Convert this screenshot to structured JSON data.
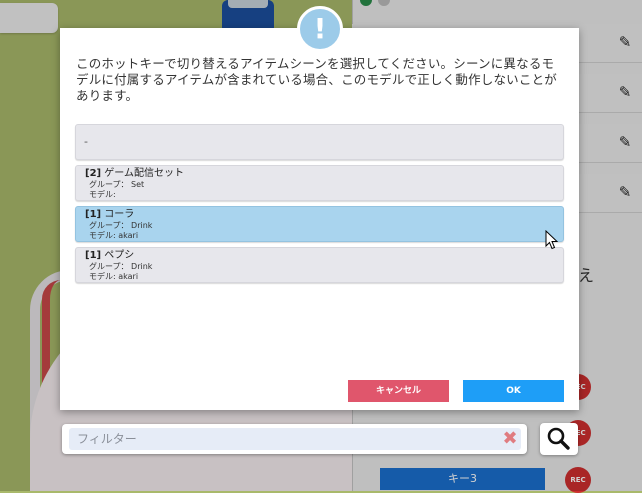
{
  "dialog": {
    "icon": "exclamation-icon",
    "message": "このホットキーで切り替えるアイテムシーンを選択してください。シーンに異なるモデルに付属するアイテムが含まれている場合、このモデルで正しく動作しないことがあります。",
    "items": [
      {
        "title": "-",
        "group": "",
        "model": ""
      },
      {
        "id": "[2]",
        "name": "ゲーム配信セット",
        "group": "グループ： Set",
        "model": "モデル:"
      },
      {
        "id": "[1]",
        "name": "コーラ",
        "group": "グループ： Drink",
        "model": "モデル: akari",
        "selected": true
      },
      {
        "id": "[1]",
        "name": "ペプシ",
        "group": "グループ： Drink",
        "model": "モデル: akari"
      }
    ],
    "cancel_label": "キャンセル",
    "ok_label": "OK"
  },
  "filter": {
    "placeholder": "フィルター"
  },
  "background": {
    "key_button": "キー3",
    "rec_label": "REC",
    "edge_text": "え"
  },
  "colors": {
    "selected_item": "#a9d4ee",
    "cancel_button": "#e0566c",
    "ok_button": "#1e9ef7",
    "badge": "#9ccbe9"
  }
}
